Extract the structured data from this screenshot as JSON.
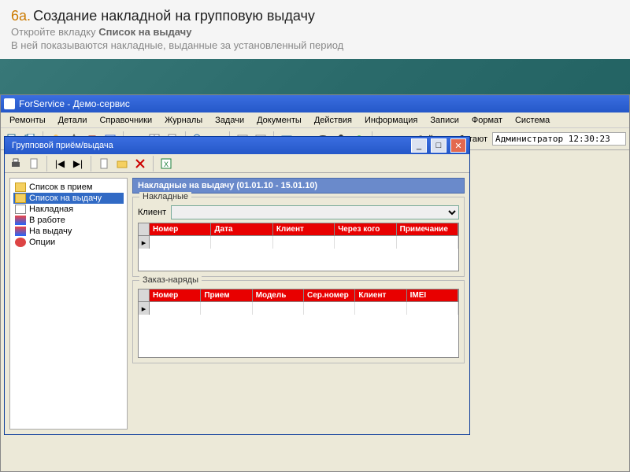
{
  "slide": {
    "step_num": "6a.",
    "step_title": "Создание накладной на групповую выдачу",
    "line2_a": "Откройте вкладку ",
    "line2_b": "Список на выдачу",
    "line3": "В ней показываются накладные, выданные за установленный период"
  },
  "app": {
    "title": "ForService - Демо-сервис",
    "menu": [
      "Ремонты",
      "Детали",
      "Справочники",
      "Журналы",
      "Задачи",
      "Документы",
      "Действия",
      "Информация",
      "Записи",
      "Формат",
      "Система"
    ],
    "status_label": "Сейчас работают",
    "status_value": "Администратор 12:30:23"
  },
  "child": {
    "title": "Групповой приём/выдача",
    "tree": [
      {
        "label": "Список в прием",
        "icon": "folder-y",
        "sel": false
      },
      {
        "label": "Список на выдачу",
        "icon": "folder-o",
        "sel": true
      },
      {
        "label": "Накладная",
        "icon": "doc-ico",
        "sel": false
      },
      {
        "label": "В работе",
        "icon": "man-ico",
        "sel": false
      },
      {
        "label": "На выдачу",
        "icon": "man-ico",
        "sel": false
      },
      {
        "label": "Опции",
        "icon": "gear-ico",
        "sel": false
      }
    ],
    "panel_title": "Накладные на выдачу (01.01.10 - 15.01.10)",
    "fs1_legend": "Накладные",
    "client_label": "Клиент",
    "grid1_cols": [
      "Номер",
      "Дата",
      "Клиент",
      "Через кого",
      "Примечание"
    ],
    "fs2_legend": "Заказ-наряды",
    "grid2_cols": [
      "Номер",
      "Прием",
      "Модель",
      "Сер.номер",
      "Клиент",
      "IMEI"
    ]
  }
}
